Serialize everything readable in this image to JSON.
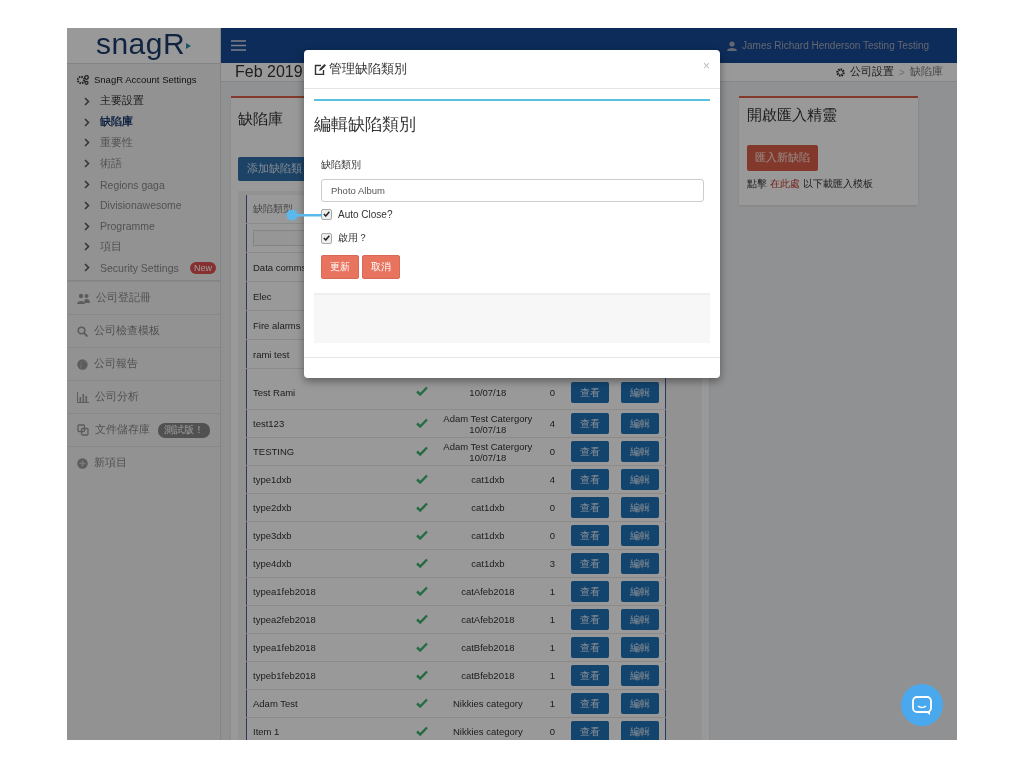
{
  "logo": "snagR",
  "sidebar": {
    "section_title": "SnagR Account Settings",
    "settings_menu": [
      {
        "label": "主要設置",
        "selected": false,
        "disabled": false
      },
      {
        "label": "缺陷庫",
        "selected": true,
        "disabled": false
      },
      {
        "label": "重要性",
        "selected": false,
        "disabled": true
      },
      {
        "label": "術語",
        "selected": false,
        "disabled": true
      },
      {
        "label": "Regions gaga",
        "selected": false,
        "disabled": true
      },
      {
        "label": "Divisionawesome",
        "selected": false,
        "disabled": true
      },
      {
        "label": "Programme",
        "selected": false,
        "disabled": true
      },
      {
        "label": "項目",
        "selected": false,
        "disabled": true
      },
      {
        "label": "Security Settings",
        "selected": false,
        "disabled": true,
        "badge": "New"
      }
    ],
    "main_menu": [
      {
        "label": "公司登記冊"
      },
      {
        "label": "公司檢查模板"
      },
      {
        "label": "公司報告"
      },
      {
        "label": "公司分析"
      },
      {
        "label": "文件儲存庫",
        "badge": "測試版！"
      },
      {
        "label": "新項目"
      }
    ]
  },
  "header": {
    "user": "James Richard Henderson Testing Testing"
  },
  "page_title": "Feb 2019",
  "breadcrumb": [
    "公司設置",
    "缺陷庫"
  ],
  "breadcrumb_separator": ">",
  "library_panel": {
    "title": "缺陷庫",
    "add_button": "添加缺陷類",
    "table": {
      "column_1": "缺陷類型",
      "rows": [
        {
          "name": "Data comms"
        },
        {
          "name": "Elec"
        },
        {
          "name": "Fire alarms"
        },
        {
          "name": "rami test"
        },
        {
          "name": "Test Rami",
          "active": true,
          "category": [
            "10/07/18"
          ],
          "count": "0",
          "view": "查看",
          "edit": "編輯"
        },
        {
          "name": "test123",
          "active": true,
          "category": [
            "Adam Test Catergory",
            "10/07/18"
          ],
          "count": "4",
          "view": "查看",
          "edit": "編輯"
        },
        {
          "name": "TESTING",
          "active": true,
          "category": [
            "Adam Test Catergory",
            "10/07/18"
          ],
          "count": "0",
          "view": "查看",
          "edit": "編輯"
        },
        {
          "name": "type1dxb",
          "active": true,
          "category": [
            "cat1dxb"
          ],
          "count": "4",
          "view": "查看",
          "edit": "編輯"
        },
        {
          "name": "type2dxb",
          "active": true,
          "category": [
            "cat1dxb"
          ],
          "count": "0",
          "view": "查看",
          "edit": "編輯"
        },
        {
          "name": "type3dxb",
          "active": true,
          "category": [
            "cat1dxb"
          ],
          "count": "0",
          "view": "查看",
          "edit": "編輯"
        },
        {
          "name": "type4dxb",
          "active": true,
          "category": [
            "cat1dxb"
          ],
          "count": "3",
          "view": "查看",
          "edit": "編輯"
        },
        {
          "name": "typea1feb2018",
          "active": true,
          "category": [
            "catAfeb2018"
          ],
          "count": "1",
          "view": "查看",
          "edit": "編輯"
        },
        {
          "name": "typea2feb2018",
          "active": true,
          "category": [
            "catAfeb2018"
          ],
          "count": "1",
          "view": "查看",
          "edit": "編輯"
        },
        {
          "name": "typea1feb2018",
          "active": true,
          "category": [
            "catBfeb2018"
          ],
          "count": "1",
          "view": "查看",
          "edit": "編輯"
        },
        {
          "name": "typeb1feb2018",
          "active": true,
          "category": [
            "catBfeb2018"
          ],
          "count": "1",
          "view": "查看",
          "edit": "編輯"
        },
        {
          "name": "Adam Test",
          "active": true,
          "category": [
            "Nikkies category"
          ],
          "count": "1",
          "view": "查看",
          "edit": "編輯"
        },
        {
          "name": "Item 1",
          "active": true,
          "category": [
            "Nikkies category"
          ],
          "count": "0",
          "view": "查看",
          "edit": "編輯"
        }
      ]
    }
  },
  "import_panel": {
    "title": "開啟匯入精靈",
    "button": "匯入新缺陷",
    "hint_before": "點擊",
    "hint_link": "在此處",
    "hint_after": "以下載匯入模板"
  },
  "modal": {
    "title": "管理缺陷類別",
    "close": "×",
    "heading": "編輯缺陷類別",
    "field_label": "缺陷類別",
    "field_value": "Photo Album",
    "checkboxes": [
      {
        "label": "Auto Close?",
        "checked": true
      },
      {
        "label": "啟用？",
        "checked": true
      }
    ],
    "buttons": [
      "更新",
      "取消"
    ]
  }
}
